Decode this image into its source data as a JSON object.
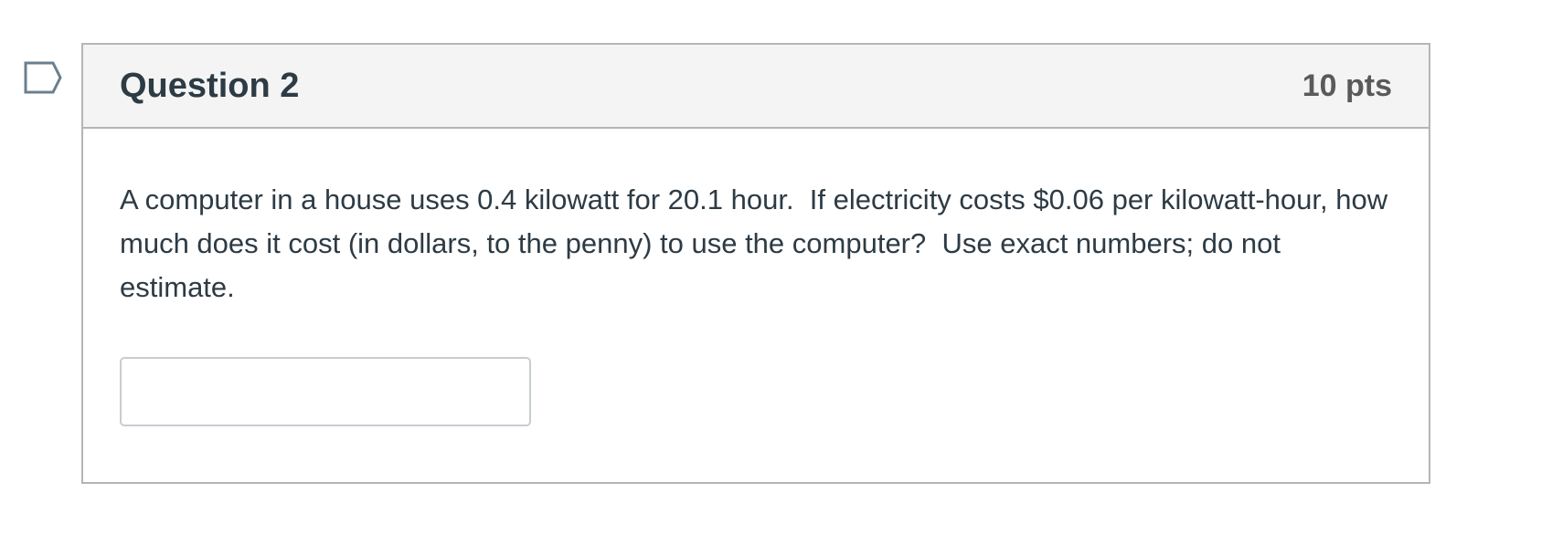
{
  "question": {
    "title": "Question 2",
    "points": "10 pts",
    "text": "A computer in a house uses 0.4 kilowatt for 20.1 hour.  If electricity costs $0.06 per kilowatt-hour, how much does it cost (in dollars, to the penny) to use the computer?  Use exact numbers; do not estimate.",
    "answer_value": ""
  },
  "icons": {
    "flag": "flag-question-icon"
  },
  "colors": {
    "header_bg": "#f4f4f4",
    "border": "#b5b5b5",
    "text": "#2d3b45",
    "points_text": "#5a5a5a",
    "flag_outline": "#6b7f8e"
  }
}
